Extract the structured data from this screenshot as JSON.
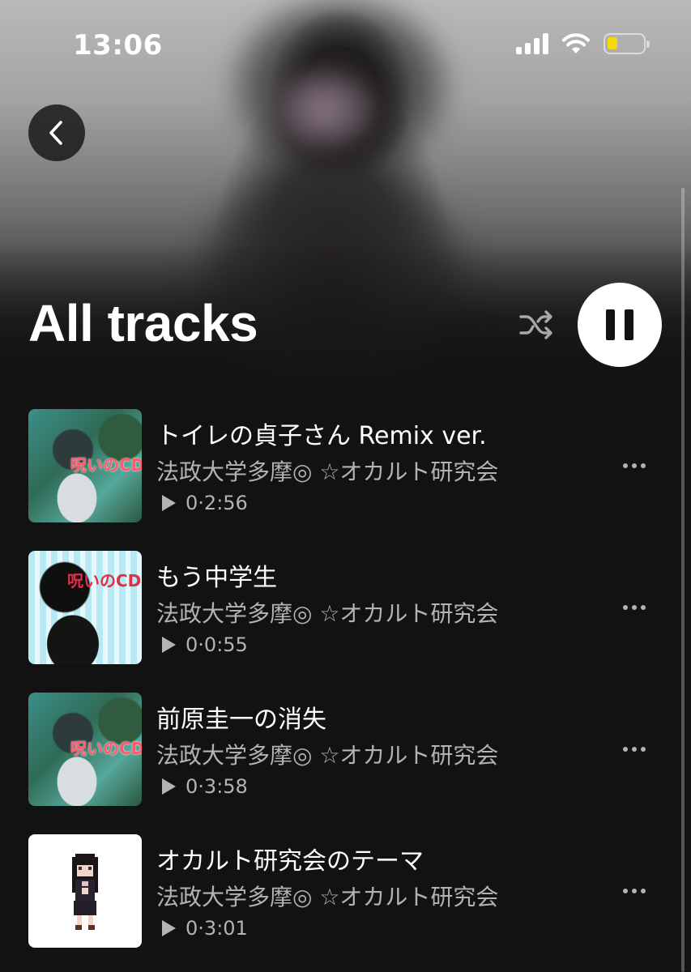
{
  "status_bar": {
    "time": "13:06",
    "battery_color": "#f5d90a"
  },
  "header": {
    "title": "All tracks",
    "back_icon": "chevron-left-icon",
    "shuffle_icon": "shuffle-icon",
    "play_state": "pause"
  },
  "tracks": [
    {
      "title": "トイレの貞子さん Remix ver.",
      "artist": "法政大学多摩◎ ☆オカルト研究会",
      "plays": "0",
      "duration": "2:56",
      "art_text": "呪いのCD"
    },
    {
      "title": "もう中学生",
      "artist": "法政大学多摩◎ ☆オカルト研究会",
      "plays": "0",
      "duration": "0:55",
      "art_text": "呪いのCD"
    },
    {
      "title": "前原圭一の消失",
      "artist": "法政大学多摩◎ ☆オカルト研究会",
      "plays": "0",
      "duration": "3:58",
      "art_text": "呪いのCD"
    },
    {
      "title": "オカルト研究会のテーマ",
      "artist": "法政大学多摩◎ ☆オカルト研究会",
      "plays": "0",
      "duration": "3:01"
    }
  ]
}
